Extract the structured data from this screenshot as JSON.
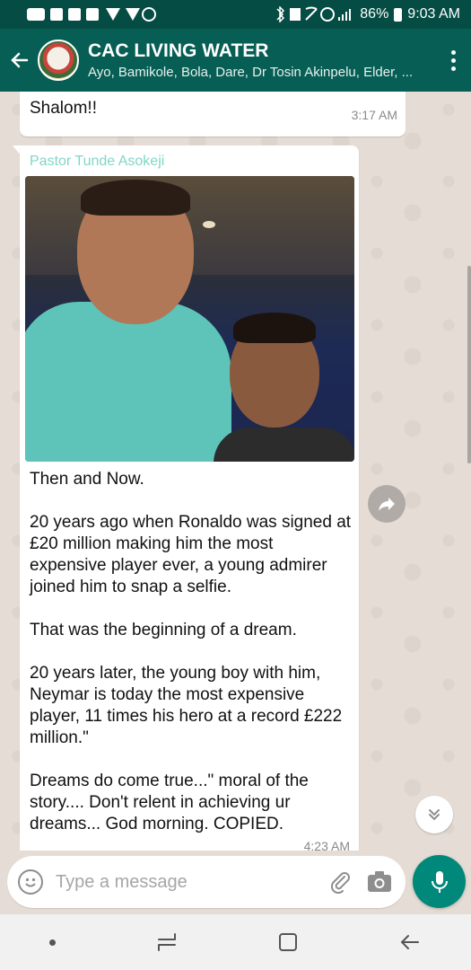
{
  "status_bar": {
    "battery": "86%",
    "time": "9:03 AM"
  },
  "header": {
    "title": "CAC LIVING WATER",
    "members": "Ayo, Bamikole, Bola, Dare, Dr Tosin Akinpelu, Elder, ..."
  },
  "messages": [
    {
      "text": "Shalom!!",
      "time": "3:17 AM"
    },
    {
      "sender": "Pastor Tunde Asokeji",
      "paragraphs": [
        "Then and Now.",
        "20 years ago when Ronaldo was signed at £20 million making him the most expensive player ever, a young admirer joined him to snap a selfie.",
        "That was the beginning of a dream.",
        "20 years later, the young boy with him, Neymar is today the most expensive player, 11 times his hero at a record £222 million.\"",
        "Dreams do come true...\" moral of the story.... Don't relent in achieving ur dreams... God morning. COPIED."
      ],
      "time": "4:23 AM"
    }
  ],
  "composer": {
    "placeholder": "Type a message"
  },
  "colors": {
    "header": "#075e54",
    "statusbar": "#054d44",
    "accent": "#00897b",
    "sender_name": "#7fd7c6"
  },
  "icons": [
    "back-arrow-icon",
    "more-vert-icon",
    "forward-icon",
    "chevron-down-icon",
    "emoji-icon",
    "attach-icon",
    "camera-icon",
    "mic-icon"
  ]
}
